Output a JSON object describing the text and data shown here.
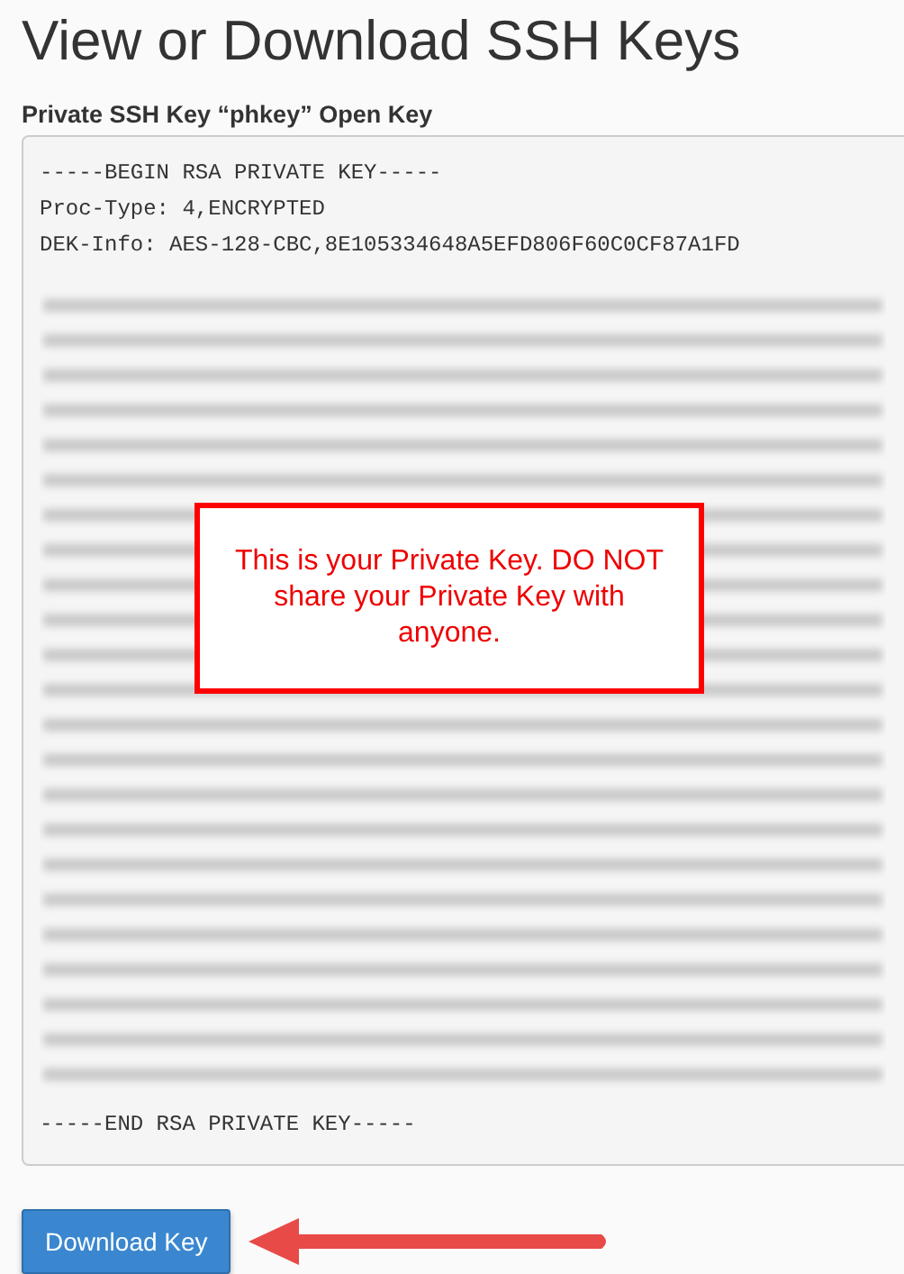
{
  "page_title": "View or Download SSH Keys",
  "key_heading": "Private SSH Key “phkey” Open Key",
  "key_header_lines": [
    "-----BEGIN RSA PRIVATE KEY-----",
    "Proc-Type: 4,ENCRYPTED",
    "DEK-Info: AES-128-CBC,8E105334648A5EFD806F60C0CF87A1FD"
  ],
  "key_footer_line": "-----END RSA PRIVATE KEY-----",
  "callout": "This is your Private Key. DO NOT share your Private Key with anyone.",
  "download_button": "Download Key"
}
